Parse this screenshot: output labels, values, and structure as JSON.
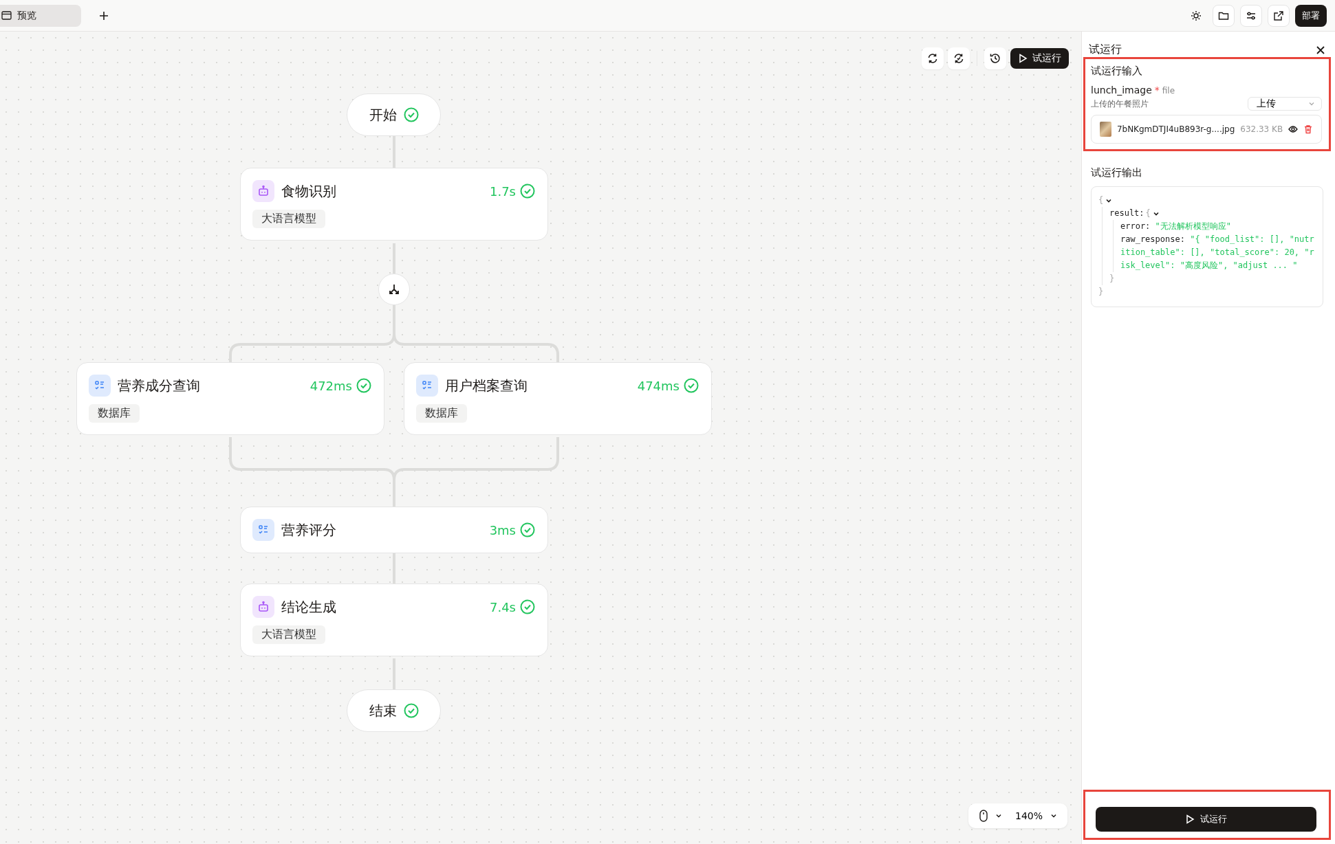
{
  "tabs": [
    {
      "label": "预览",
      "selected": true
    }
  ],
  "header": {
    "deploy_button": "部署"
  },
  "canvas": {
    "run_button": "试运行",
    "zoom": "140%",
    "nodes": [
      {
        "kind": "terminal",
        "title": "开始",
        "succeeded": true
      },
      {
        "kind": "llm",
        "title": "食物识别",
        "duration": "1.7s",
        "tag": "大语言模型",
        "succeeded": true
      },
      {
        "kind": "split"
      },
      {
        "kind": "database",
        "title": "营养成分查询",
        "duration": "472ms",
        "tag": "数据库",
        "succeeded": true
      },
      {
        "kind": "database",
        "title": "用户档案查询",
        "duration": "474ms",
        "tag": "数据库",
        "succeeded": true
      },
      {
        "kind": "database",
        "title": "营养评分",
        "duration": "3ms",
        "succeeded": true
      },
      {
        "kind": "llm",
        "title": "结论生成",
        "duration": "7.4s",
        "tag": "大语言模型",
        "succeeded": true
      },
      {
        "kind": "terminal",
        "title": "结束",
        "succeeded": true
      }
    ]
  },
  "panel": {
    "title": "试运行",
    "input_section": {
      "title": "试运行输入",
      "highlighted": true,
      "field": {
        "name": "lunch_image",
        "required_mark": "*",
        "type": "file",
        "description": "上传的午餐照片",
        "mode": "上传"
      },
      "file": {
        "name": "7bNKgmDTJI4uB893r-g....jpg",
        "size": "632.33 KB"
      }
    },
    "output_section": {
      "title": "试运行输出",
      "tree": {
        "open": "{",
        "expanded": true,
        "close": "}",
        "children": [
          {
            "key": "result:",
            "open": "{",
            "expanded": true,
            "close": "}",
            "children": [
              {
                "key": "error:",
                "value": "\"无法解析模型响应\""
              },
              {
                "key": "raw_response:",
                "value": "\"{ \"food_list\": [], \"nutrition_table\": [], \"total_score\": 20, \"risk_level\": \"高度风险\", \"adjust ... \""
              }
            ]
          }
        ]
      }
    },
    "footer": {
      "highlighted": true,
      "run_button": "试运行"
    }
  }
}
